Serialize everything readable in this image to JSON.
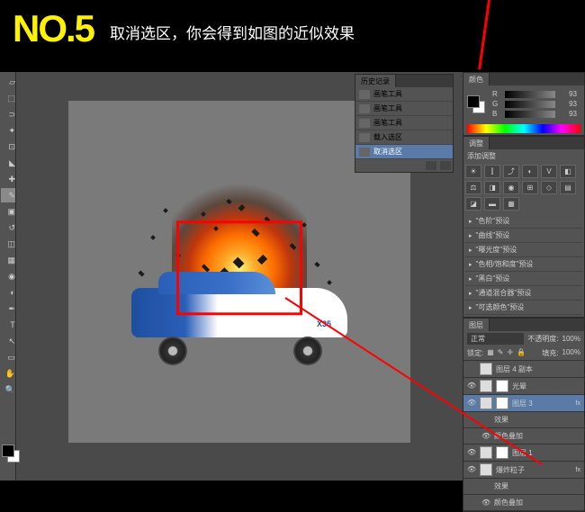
{
  "header": {
    "step": "NO.5",
    "text": "取消选区，你会得到如图的近似效果"
  },
  "history": {
    "title": "历史记录",
    "items": [
      "画笔工具",
      "画笔工具",
      "画笔工具",
      "载入选区",
      "取消选区"
    ],
    "selected": 4
  },
  "color_panel": {
    "tab": "颜色",
    "sliders": [
      {
        "label": "R",
        "val": "93"
      },
      {
        "label": "G",
        "val": "93"
      },
      {
        "label": "B",
        "val": "93"
      }
    ]
  },
  "adjustments": {
    "tab": "调整",
    "title": "添加调整"
  },
  "presets": [
    "\"色阶\"预设",
    "\"曲线\"预设",
    "\"曝光度\"预设",
    "\"色相/饱和度\"预设",
    "\"黑白\"预设",
    "\"通道混合器\"预设",
    "\"可选颜色\"预设"
  ],
  "layers": {
    "tab": "图层",
    "mode": "正常",
    "opacity_label": "不透明度:",
    "opacity": "100%",
    "lock_label": "锁定:",
    "fill_label": "填充:",
    "fill": "100%",
    "items": [
      {
        "name": "图层 4 副本",
        "eye": false
      },
      {
        "name": "光晕",
        "eye": true,
        "hasmask": true
      },
      {
        "name": "图层 3",
        "eye": true,
        "selected": true,
        "hasmask": true,
        "fx": true
      },
      {
        "name": "效果",
        "sub": true
      },
      {
        "name": "颜色叠加",
        "sub": true,
        "eye": true
      },
      {
        "name": "图层 1",
        "eye": true,
        "hasmask": true
      },
      {
        "name": "爆炸粒子",
        "eye": true,
        "fx": true
      },
      {
        "name": "效果",
        "sub": true
      },
      {
        "name": "颜色叠加",
        "sub": true,
        "eye": true
      }
    ]
  },
  "car": {
    "model": "X35"
  }
}
